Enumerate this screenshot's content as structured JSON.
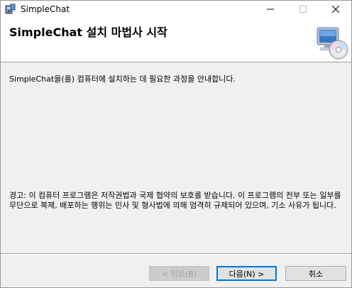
{
  "window": {
    "title": "SimpleChat",
    "controls": {
      "minimize_icon": "minimize-icon",
      "maximize_icon": "maximize-icon",
      "close_icon": "close-icon"
    }
  },
  "banner": {
    "title": "SimpleChat 설치 마법사 시작",
    "icon": "computer-cd-icon"
  },
  "body": {
    "intro": "SimpleChat을(를) 컴퓨터에 설치하는 데 필요한 과정을 안내합니다.",
    "warning": "경고: 이 컴퓨터 프로그램은 저작권법과 국제 협약의 보호를 받습니다. 이 프로그램의 전부 또는 일부를 무단으로 복제, 배포하는 행위는 민사 및 형사법에 의해 엄격히 규제되어 있으며, 기소 사유가 됩니다."
  },
  "buttons": {
    "back": "< 뒤로(B)",
    "next": "다음(N) >",
    "cancel": "취소"
  },
  "colors": {
    "accent": "#0078d7",
    "background": "#f0f0f0"
  }
}
